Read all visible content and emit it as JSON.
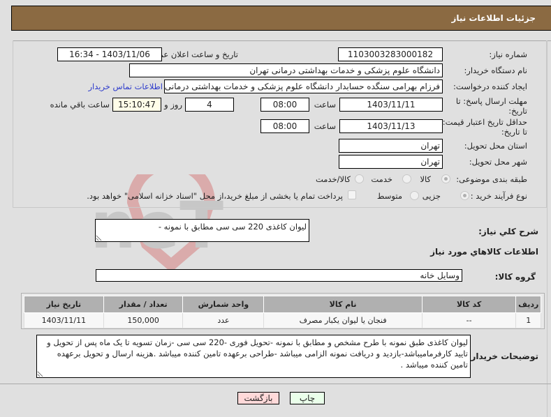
{
  "header": {
    "title": "جزئیات اطلاعات نیاز"
  },
  "form": {
    "need_number": {
      "label": "شماره نیاز:",
      "value": "1103003283000182"
    },
    "announce_datetime": {
      "label": "تاریخ و ساعت اعلان عمومی:",
      "value": "1403/11/06 - 16:34"
    },
    "buyer_org": {
      "label": "نام دستگاه خریدار:",
      "value": "دانشگاه علوم پزشکی و خدمات بهداشتی درمانی تهران"
    },
    "requester": {
      "label": "ایجاد کننده درخواست:",
      "value": "فرزام بهرامی سنگده حسابدار دانشگاه علوم پزشکی و خدمات بهداشتی درمانی"
    },
    "buyer_contact_link": "اطلاعات تماس خریدار",
    "response_deadline": {
      "label": "مهلت ارسال پاسخ: تا تاریخ:",
      "date": "1403/11/11",
      "time_label": "ساعت",
      "time": "08:00",
      "days": "4",
      "days_label": "روز و",
      "remaining": "15:10:47",
      "remaining_label": "ساعت باقي مانده"
    },
    "price_validity": {
      "label": "حداقل تاریخ اعتبار قیمت: تا تاریخ:",
      "date": "1403/11/13",
      "time_label": "ساعت",
      "time": "08:00"
    },
    "delivery_province": {
      "label": "استان محل تحویل:",
      "value": "تهران"
    },
    "delivery_city": {
      "label": "شهر محل تحویل:",
      "value": "تهران"
    },
    "category": {
      "label": "طبقه بندی موضوعی:",
      "options": [
        "کالا",
        "خدمت",
        "کالا/خدمت"
      ],
      "selected": "کالا"
    },
    "purchase_process": {
      "label": "نوع فرآیند خرید :",
      "options": [
        "جزیی",
        "متوسط"
      ],
      "selected": "جزیی",
      "treasury_note": "پرداخت تمام یا بخشی از مبلغ خرید،از محل \"اسناد خزانه اسلامی\" خواهد بود."
    }
  },
  "summary": {
    "label": "شرح كلي نياز:",
    "value": "لیوان کاغذی 220 سی سی مطابق با نمونه -"
  },
  "goods_section": {
    "title": "اطلاعات كالاهاي مورد نياز",
    "group_label": "گروه کالا:",
    "group_value": "وسایل خانه",
    "table": {
      "headers": [
        "ردیف",
        "کد کالا",
        "نام کالا",
        "واحد شمارش",
        "تعداد / مقدار",
        "تاریخ نیاز"
      ],
      "rows": [
        [
          "1",
          "--",
          "فنجان یا لیوان یکبار مصرف",
          "عدد",
          "150,000",
          "1403/11/11"
        ]
      ]
    }
  },
  "buyer_notes": {
    "label": "توضیحات خریدار:",
    "value": "لیوان کاغذی طبق نمونه با طرح مشخص و مطابق با نمونه -تحویل فوری -220 سی سی -زمان تسویه تا یک ماه پس از تحویل و تایید کارفرمامیباشد-بازدید و دریافت نمونه الزامی میباشد -طراحی برعهده تامین کننده میباشد .هزینه ارسال و تحویل برعهده تامین کننده میباشد ."
  },
  "buttons": {
    "print": "چاپ",
    "back": "بازگشت"
  },
  "colors": {
    "header_bg": "#8b6a42",
    "print_bg": "#eaffea",
    "back_bg": "#ffd9d9",
    "link": "#2c3acb"
  }
}
